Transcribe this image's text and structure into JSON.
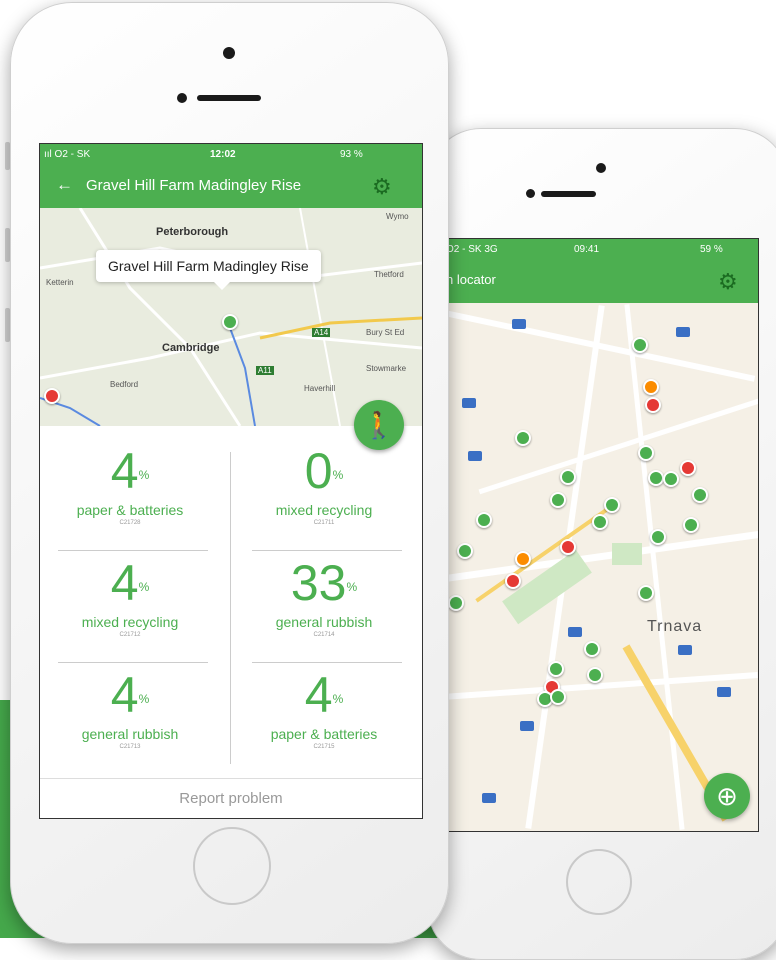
{
  "phone_main": {
    "status": {
      "carrier": "ııl O2 - SK",
      "time": "12:02",
      "battery": "93 %"
    },
    "appbar": {
      "back": "←",
      "title": "Gravel Hill Farm Madingley Rise",
      "settings_icon": "gear-icon"
    },
    "map": {
      "callout": "Gravel Hill Farm Madingley Rise",
      "labels": {
        "peterborough": "Peterborough",
        "cambridge": "Cambridge",
        "bedford": "Bedford",
        "kettering": "Ketterin",
        "haverhill": "Haverhill",
        "thetford": "Thetford",
        "bury": "Bury St Ed",
        "stowmarket": "Stowmarke",
        "wymondham": "Wymo",
        "road_a14": "A14",
        "road_a11": "A11"
      },
      "walk_icon": "pedestrian-icon"
    },
    "stats": [
      {
        "percent": "4",
        "name": "paper & batteries",
        "code": "C21728"
      },
      {
        "percent": "0",
        "name": "mixed recycling",
        "code": "C21711"
      },
      {
        "percent": "4",
        "name": "mixed recycling",
        "code": "C21712"
      },
      {
        "percent": "33",
        "name": "general rubbish",
        "code": "C21714"
      },
      {
        "percent": "4",
        "name": "general rubbish",
        "code": "C21713"
      },
      {
        "percent": "4",
        "name": "paper & batteries",
        "code": "C21715"
      }
    ],
    "percent_sign": "%",
    "report": "Report problem"
  },
  "phone_secondary": {
    "status": {
      "carrier": "O2 - SK  3G",
      "time": "09:41",
      "battery": "59 %"
    },
    "appbar": {
      "title": "n locator",
      "settings_icon": "gear-icon"
    },
    "map": {
      "city": "Trnava",
      "locate_icon": "crosshair-icon"
    }
  },
  "colors": {
    "accent": "#4caf50",
    "dark_accent": "#1b6b21",
    "pin_red": "#e53935",
    "pin_orange": "#fb8c00"
  }
}
